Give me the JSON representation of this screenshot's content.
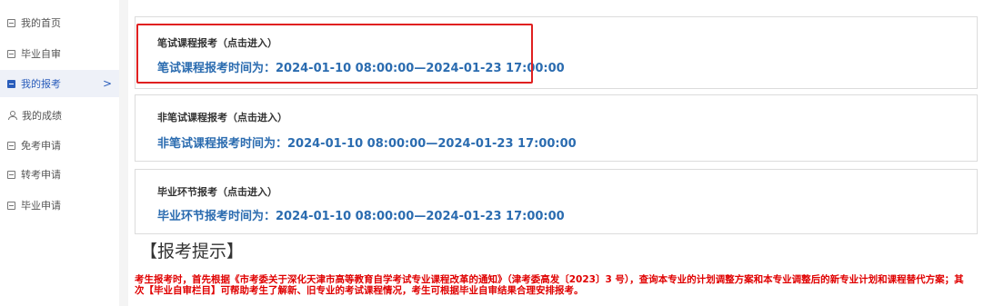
{
  "sidebar": {
    "items": [
      {
        "label": "我的首页",
        "icon": "id-card-icon"
      },
      {
        "label": "毕业自审",
        "icon": "id-card-icon"
      },
      {
        "label": "我的报考",
        "icon": "id-card-icon",
        "active": true
      },
      {
        "label": "我的成绩",
        "icon": "user-icon"
      },
      {
        "label": "免考申请",
        "icon": "doc-icon"
      },
      {
        "label": "转考申请",
        "icon": "grid-icon"
      },
      {
        "label": "毕业申请",
        "icon": "grid-icon"
      }
    ],
    "active_chevron": ">"
  },
  "cards": [
    {
      "title": "笔试课程报考（点击进入）",
      "time": "笔试课程报考时间为：2024-01-10 08:00:00—2024-01-23 17:00:00"
    },
    {
      "title": "非笔试课程报考（点击进入）",
      "time": "非笔试课程报考时间为：2024-01-10 08:00:00—2024-01-23 17:00:00"
    },
    {
      "title": "毕业环节报考（点击进入）",
      "time": "毕业环节报考时间为：2024-01-10 08:00:00—2024-01-23 17:00:00"
    }
  ],
  "tips": {
    "heading": "【报考提示】",
    "text": "考生报考时，首先根据《市考委关于深化天津市高等教育自学考试专业课程改革的通知》（津考委高发〔2023〕3 号），查询本专业的计划调整方案和本专业调整后的新专业计划和课程替代方案；其次【毕业自审栏目】可帮助考生了解新、旧专业的考试课程情况，考生可根据毕业自审结果合理安排报考。"
  },
  "colors": {
    "accent": "#2b6cb0",
    "highlight_border": "#e02020",
    "tip_text": "#e00000",
    "active_bg": "#eef1f8"
  }
}
